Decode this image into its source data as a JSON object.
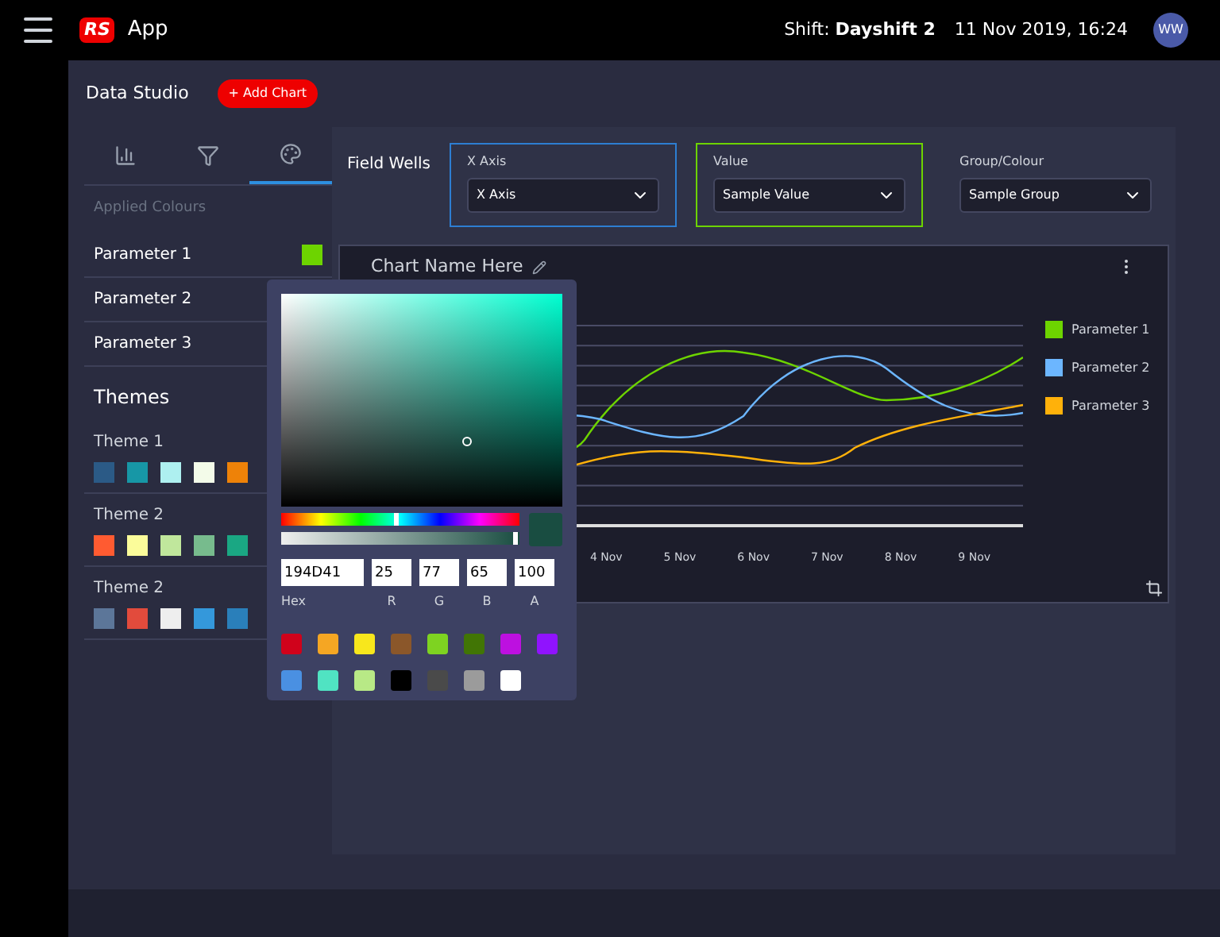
{
  "header": {
    "app_name": "App",
    "logo": "RS",
    "shift_label": "Shift:",
    "shift_value": "Dayshift 2",
    "datetime": "11 Nov 2019, 16:24",
    "avatar": "WW"
  },
  "toolbar": {
    "title": "Data Studio",
    "add_button": "+ Add Chart"
  },
  "sidebar": {
    "tabs": [
      {
        "kind": "bars",
        "selected": false
      },
      {
        "kind": "filter",
        "selected": false
      },
      {
        "kind": "palette",
        "selected": true
      }
    ],
    "applied_heading": "Applied Colours",
    "parameters": [
      {
        "label": "Parameter 1",
        "color": "#6dd400"
      },
      {
        "label": "Parameter 2"
      },
      {
        "label": "Parameter 3"
      }
    ],
    "themes_heading": "Themes",
    "themes": [
      {
        "name": "Theme 1",
        "swatches": [
          {
            "color": "#2b5a86"
          },
          {
            "color": "#1797a6"
          },
          {
            "color": "#aef0f0"
          },
          {
            "color": "#f3fbe9"
          },
          {
            "color": "#ee8208"
          }
        ]
      },
      {
        "name": "Theme 2",
        "swatches": [
          {
            "color": "#ff5b31"
          },
          {
            "color": "#fbfc9a"
          },
          {
            "color": "#c0e79c"
          },
          {
            "color": "#77bb8d"
          },
          {
            "color": "#1aa783"
          }
        ]
      },
      {
        "name": "Theme 2",
        "swatches": [
          {
            "color": "#5c7699"
          },
          {
            "color": "#e24b3c"
          },
          {
            "color": "#eeeeee"
          },
          {
            "color": "#3498db"
          },
          {
            "color": "#2a7fba"
          }
        ]
      }
    ]
  },
  "field_wells": {
    "label": "Field Wells",
    "wells": [
      {
        "label": "X Axis",
        "value": "X Axis",
        "color": "#2d7ed2"
      },
      {
        "label": "Value",
        "value": "Sample Value",
        "color": "#6dd400"
      },
      {
        "label": "Group/Colour",
        "value": "Sample Group"
      }
    ]
  },
  "chart": {
    "title": "Chart Name Here",
    "x_labels": [
      "4 Nov",
      "5 Nov",
      "6 Nov",
      "7 Nov",
      "8 Nov",
      "9 Nov"
    ],
    "legend": [
      {
        "label": "Parameter 1",
        "color": "#6dd400"
      },
      {
        "label": "Parameter 2",
        "color": "#6cb6ff"
      },
      {
        "label": "Parameter 3",
        "color": "#ffb10a"
      }
    ]
  },
  "color_picker": {
    "hue": {
      "level": 0.47
    },
    "alpha": {
      "level": 0.97
    },
    "preview": {
      "color": "#194d41"
    },
    "fields": [
      {
        "value": "194D41",
        "label": "Hex"
      },
      {
        "value": "25",
        "label": "R"
      },
      {
        "value": "77",
        "label": "G"
      },
      {
        "value": "65",
        "label": "B"
      },
      {
        "value": "100",
        "label": "A"
      }
    ],
    "swatches": [
      [
        {
          "color": "#d0021b"
        },
        {
          "color": "#f5a623"
        },
        {
          "color": "#f8e71c"
        },
        {
          "color": "#8b572a"
        },
        {
          "color": "#7ed321"
        },
        {
          "color": "#417505"
        },
        {
          "color": "#bd10e0"
        },
        {
          "color": "#9013fe"
        }
      ],
      [
        {
          "color": "#4a90e2"
        },
        {
          "color": "#50e3c2"
        },
        {
          "color": "#b8e986"
        },
        {
          "color": "#000000"
        },
        {
          "color": "#4a4a4a"
        },
        {
          "color": "#9b9b9b"
        },
        {
          "color": "#ffffff"
        }
      ]
    ]
  }
}
